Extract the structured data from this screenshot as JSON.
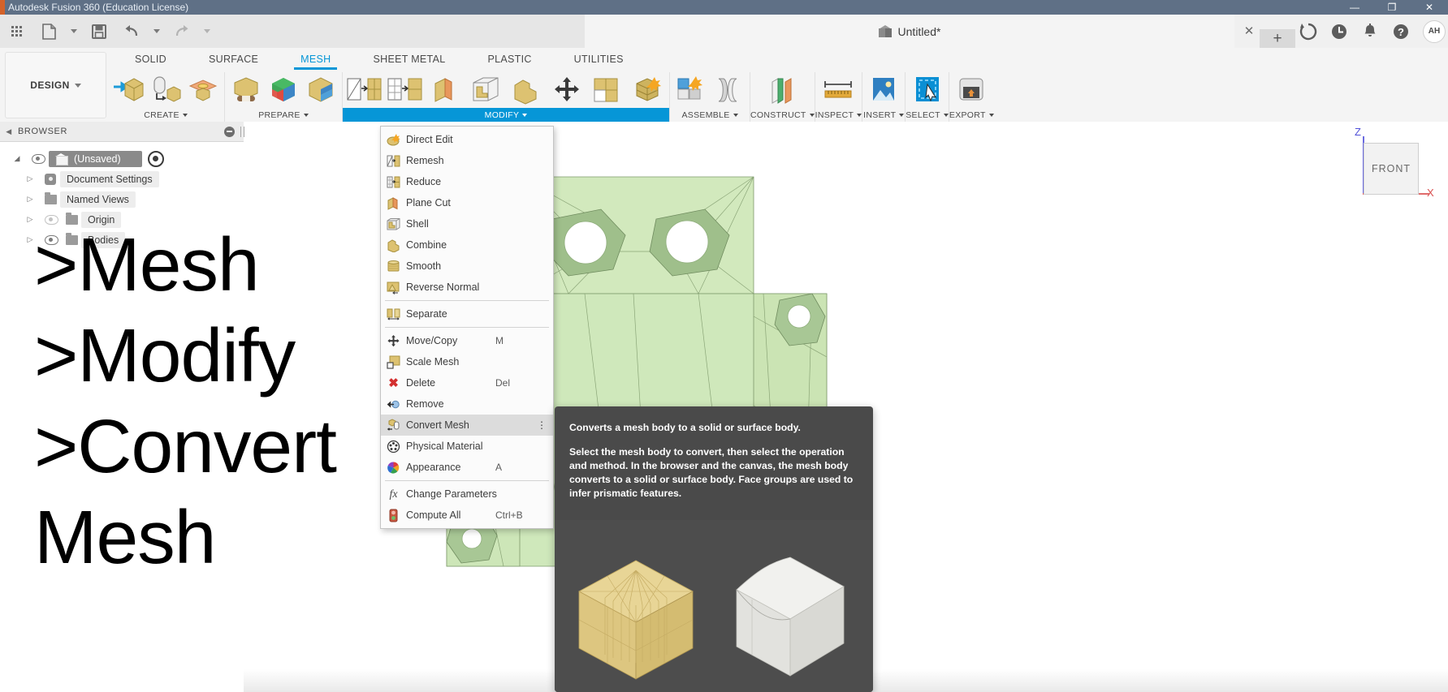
{
  "window": {
    "title": "Autodesk Fusion 360 (Education License)",
    "controls": [
      "—",
      "❐",
      "✕"
    ]
  },
  "quick_access": {
    "items": [
      {
        "name": "app-grid",
        "icon": "grid-icon"
      },
      {
        "name": "new-file",
        "icon": "file-icon"
      },
      {
        "name": "save",
        "icon": "save-icon"
      },
      {
        "name": "undo",
        "icon": "undo-icon"
      },
      {
        "name": "redo",
        "icon": "redo-icon"
      }
    ]
  },
  "document_tab": {
    "title": "Untitled*",
    "close_label": "✕",
    "new_tab_label": "+"
  },
  "right_icons": [
    {
      "name": "job-status-icon",
      "glyph": "↻"
    },
    {
      "name": "recent-activity-icon",
      "glyph": "◕"
    },
    {
      "name": "notifications-icon",
      "glyph": "🔔"
    },
    {
      "name": "help-icon",
      "glyph": "?"
    }
  ],
  "account": {
    "initials": "AH"
  },
  "workspace": {
    "label": "DESIGN"
  },
  "ribbon": {
    "tabs": [
      {
        "label": "SOLID",
        "active": false
      },
      {
        "label": "SURFACE",
        "active": false
      },
      {
        "label": "MESH",
        "active": true
      },
      {
        "label": "SHEET METAL",
        "active": false
      },
      {
        "label": "PLASTIC",
        "active": false
      },
      {
        "label": "UTILITIES",
        "active": false
      }
    ],
    "panels": [
      {
        "label": "CREATE",
        "active": false,
        "tools": 3
      },
      {
        "label": "PREPARE",
        "active": false,
        "tools": 3
      },
      {
        "label": "MODIFY",
        "active": true,
        "tools": 6
      },
      {
        "label": "ASSEMBLE",
        "active": false,
        "tools": 2
      },
      {
        "label": "CONSTRUCT",
        "active": false,
        "tools": 1
      },
      {
        "label": "INSPECT",
        "active": false,
        "tools": 1
      },
      {
        "label": "INSERT",
        "active": false,
        "tools": 1
      },
      {
        "label": "SELECT",
        "active": false,
        "tools": 1
      },
      {
        "label": "EXPORT",
        "active": false,
        "tools": 1
      }
    ]
  },
  "browser": {
    "title": "BROWSER",
    "items": [
      {
        "label": "(Unsaved)",
        "icon": "component-icon",
        "eye": "visible",
        "root": true
      },
      {
        "label": "Document Settings",
        "icon": "gear-icon",
        "eye": "none"
      },
      {
        "label": "Named Views",
        "icon": "folder-icon",
        "eye": "none"
      },
      {
        "label": "Origin",
        "icon": "folder-icon",
        "eye": "hidden"
      },
      {
        "label": "Bodies",
        "icon": "folder-icon",
        "eye": "visible"
      }
    ]
  },
  "annotation": {
    "text": ">Mesh\n>Modify\n>Convert\nMesh"
  },
  "menu": {
    "items": [
      {
        "label": "Direct Edit",
        "shortcut": "",
        "icon": "direct-edit-icon",
        "selected": false,
        "separator_after": false
      },
      {
        "label": "Remesh",
        "shortcut": "",
        "icon": "remesh-icon",
        "selected": false,
        "separator_after": false
      },
      {
        "label": "Reduce",
        "shortcut": "",
        "icon": "reduce-icon",
        "selected": false,
        "separator_after": false
      },
      {
        "label": "Plane Cut",
        "shortcut": "",
        "icon": "plane-cut-icon",
        "selected": false,
        "separator_after": false
      },
      {
        "label": "Shell",
        "shortcut": "",
        "icon": "shell-icon",
        "selected": false,
        "separator_after": false
      },
      {
        "label": "Combine",
        "shortcut": "",
        "icon": "combine-icon",
        "selected": false,
        "separator_after": false
      },
      {
        "label": "Smooth",
        "shortcut": "",
        "icon": "smooth-icon",
        "selected": false,
        "separator_after": false
      },
      {
        "label": "Reverse Normal",
        "shortcut": "",
        "icon": "reverse-normal-icon",
        "selected": false,
        "separator_after": true
      },
      {
        "label": "Separate",
        "shortcut": "",
        "icon": "separate-icon",
        "selected": false,
        "separator_after": true
      },
      {
        "label": "Move/Copy",
        "shortcut": "M",
        "icon": "move-copy-icon",
        "selected": false,
        "separator_after": false
      },
      {
        "label": "Scale Mesh",
        "shortcut": "",
        "icon": "scale-mesh-icon",
        "selected": false,
        "separator_after": false
      },
      {
        "label": "Delete",
        "shortcut": "Del",
        "icon": "delete-icon",
        "selected": false,
        "separator_after": false
      },
      {
        "label": "Remove",
        "shortcut": "",
        "icon": "remove-icon",
        "selected": false,
        "separator_after": false
      },
      {
        "label": "Convert Mesh",
        "shortcut": "",
        "icon": "convert-mesh-icon",
        "selected": true,
        "overflow": "⋮",
        "separator_after": false
      },
      {
        "label": "Physical Material",
        "shortcut": "",
        "icon": "physical-material-icon",
        "selected": false,
        "separator_after": false
      },
      {
        "label": "Appearance",
        "shortcut": "A",
        "icon": "appearance-icon",
        "selected": false,
        "separator_after": true
      },
      {
        "label": "Change Parameters",
        "shortcut": "",
        "icon": "change-parameters-icon",
        "selected": false,
        "separator_after": false
      },
      {
        "label": "Compute All",
        "shortcut": "Ctrl+B",
        "icon": "compute-all-icon",
        "selected": false,
        "separator_after": false
      }
    ]
  },
  "tooltip": {
    "heading": "Converts a mesh body to a solid or surface body.",
    "body": "Select the mesh body to convert, then select the operation and method. In the browser and the canvas, the mesh body converts to a solid or surface body. Face groups are used to infer prismatic features."
  },
  "viewcube": {
    "face": "FRONT",
    "axis_z": "Z",
    "axis_x": "X",
    "z_color": "#5050d8",
    "x_color": "#d85050"
  },
  "colors": {
    "accent": "#0696d7",
    "titlebar": "#5f7086",
    "mesh_green": "#cfe8bb",
    "mesh_edge": "#7f9a6c",
    "tooltip_bg": "#4a4a4a",
    "selected_menu": "#dcdcdc"
  }
}
